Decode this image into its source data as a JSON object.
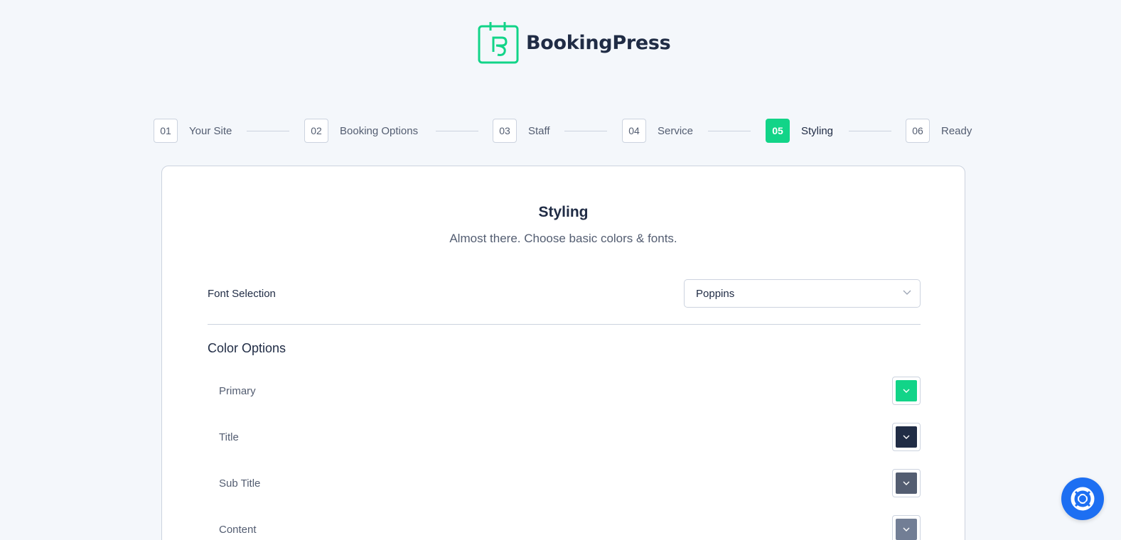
{
  "brand": {
    "name": "BookingPress",
    "accent": "#12d488"
  },
  "steps": [
    {
      "num": "01",
      "label": "Your Site",
      "active": false
    },
    {
      "num": "02",
      "label": "Booking Options",
      "active": false
    },
    {
      "num": "03",
      "label": "Staff",
      "active": false
    },
    {
      "num": "04",
      "label": "Service",
      "active": false
    },
    {
      "num": "05",
      "label": "Styling",
      "active": true
    },
    {
      "num": "06",
      "label": "Ready",
      "active": false
    }
  ],
  "card": {
    "title": "Styling",
    "subtitle": "Almost there. Choose basic colors & fonts."
  },
  "font_selection": {
    "label": "Font Selection",
    "value": "Poppins"
  },
  "color_options": {
    "title": "Color Options",
    "items": [
      {
        "label": "Primary",
        "color": "#12d488"
      },
      {
        "label": "Title",
        "color": "#202c45"
      },
      {
        "label": "Sub Title",
        "color": "#535d71"
      },
      {
        "label": "Content",
        "color": "#727e95"
      }
    ]
  },
  "help": {
    "icon": "lifebuoy-icon",
    "color": "#1d6ff2"
  }
}
